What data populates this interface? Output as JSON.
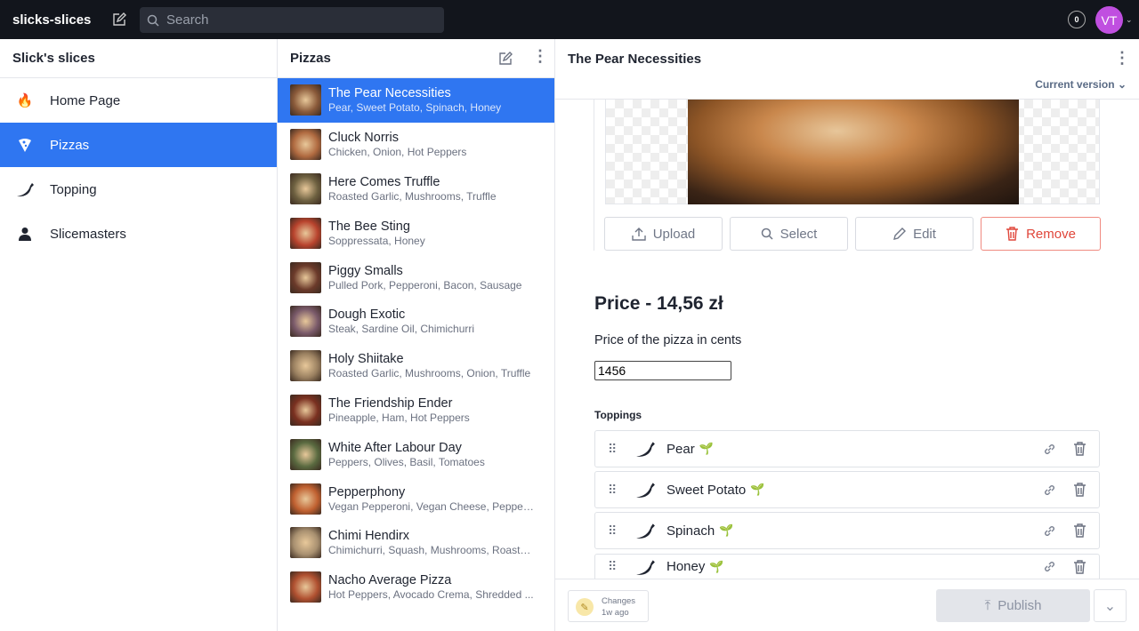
{
  "app": {
    "title": "slicks-slices",
    "search_placeholder": "Search",
    "notifications": "0",
    "avatar_initials": "VT"
  },
  "nav": {
    "title": "Slick's slices",
    "items": [
      {
        "label": "Home Page",
        "icon": "fire-icon"
      },
      {
        "label": "Pizzas",
        "icon": "pizza-icon",
        "selected": true
      },
      {
        "label": "Topping",
        "icon": "pepper-icon"
      },
      {
        "label": "Slicemasters",
        "icon": "person-icon"
      }
    ]
  },
  "list": {
    "title": "Pizzas",
    "items": [
      {
        "title": "The Pear Necessities",
        "sub": "Pear, Sweet Potato, Spinach, Honey",
        "selected": true
      },
      {
        "title": "Cluck Norris",
        "sub": "Chicken, Onion, Hot Peppers"
      },
      {
        "title": "Here Comes Truffle",
        "sub": "Roasted Garlic, Mushrooms, Truffle"
      },
      {
        "title": "The Bee Sting",
        "sub": "Soppressata, Honey"
      },
      {
        "title": "Piggy Smalls",
        "sub": "Pulled Pork, Pepperoni, Bacon, Sausage"
      },
      {
        "title": "Dough Exotic",
        "sub": "Steak, Sardine Oil, Chimichurri"
      },
      {
        "title": "Holy Shiitake",
        "sub": "Roasted Garlic, Mushrooms, Onion, Truffle"
      },
      {
        "title": "The Friendship Ender",
        "sub": "Pineapple, Ham, Hot Peppers"
      },
      {
        "title": "White After Labour Day",
        "sub": "Peppers, Olives, Basil, Tomatoes"
      },
      {
        "title": "Pepperphony",
        "sub": "Vegan Pepperoni, Vegan Cheese, Pepper..."
      },
      {
        "title": "Chimi Hendirx",
        "sub": "Chimichurri, Squash, Mushrooms, Roaste..."
      },
      {
        "title": "Nacho Average Pizza",
        "sub": "Hot Peppers, Avocado Crema, Shredded ..."
      }
    ]
  },
  "doc": {
    "title": "The Pear Necessities",
    "version": "Current version",
    "image_buttons": {
      "upload": "Upload",
      "select": "Select",
      "edit": "Edit",
      "remove": "Remove"
    },
    "price_heading": "Price - 14,56 zł",
    "price_label": "Price of the pizza in cents",
    "price_value": "1456",
    "toppings_label": "Toppings",
    "toppings": [
      "Pear",
      "Sweet Potato",
      "Spinach",
      "Honey"
    ]
  },
  "footer": {
    "changes": "Changes",
    "changes_time": "1w ago",
    "publish": "Publish"
  },
  "colors": {
    "accent": "#2f76f1",
    "danger": "#e0463a",
    "topbar": "#12151c",
    "avatar": "#c04fe0"
  }
}
